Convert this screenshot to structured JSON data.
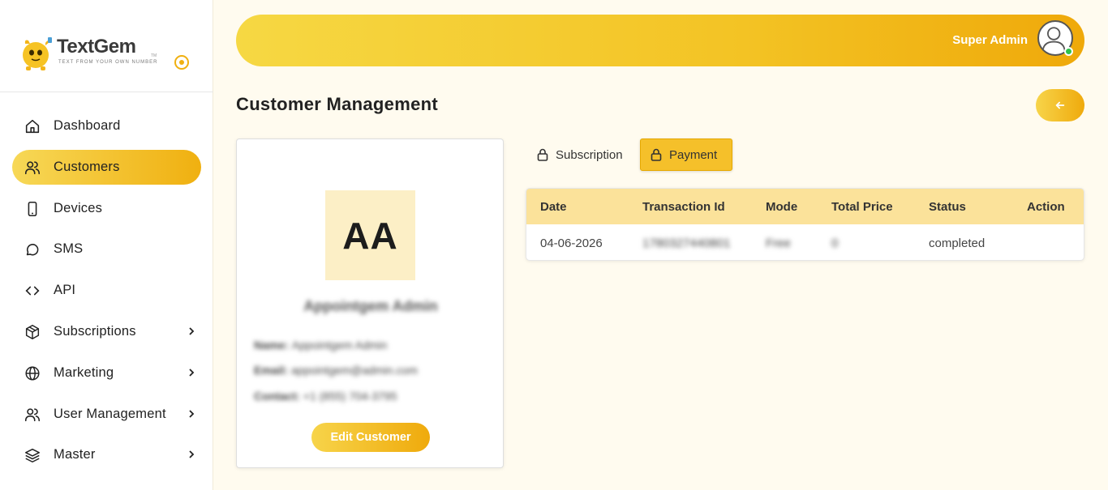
{
  "brand": {
    "name": "TextGem",
    "tagline": "TEXT FROM YOUR OWN NUMBER",
    "tm": "TM"
  },
  "sidebar": {
    "items": [
      {
        "label": "Dashboard",
        "icon": "home-icon",
        "active": false,
        "expandable": false
      },
      {
        "label": "Customers",
        "icon": "users-icon",
        "active": true,
        "expandable": false
      },
      {
        "label": "Devices",
        "icon": "phone-icon",
        "active": false,
        "expandable": false
      },
      {
        "label": "SMS",
        "icon": "chat-bubble-icon",
        "active": false,
        "expandable": false
      },
      {
        "label": "API",
        "icon": "code-icon",
        "active": false,
        "expandable": false
      },
      {
        "label": "Subscriptions",
        "icon": "package-icon",
        "active": false,
        "expandable": true
      },
      {
        "label": "Marketing",
        "icon": "globe-icon",
        "active": false,
        "expandable": true
      },
      {
        "label": "User Management",
        "icon": "users-icon",
        "active": false,
        "expandable": true
      },
      {
        "label": "Master",
        "icon": "layers-icon",
        "active": false,
        "expandable": true
      }
    ]
  },
  "header": {
    "user_name": "Super Admin",
    "status_color": "#2fc24a"
  },
  "page": {
    "title": "Customer Management"
  },
  "customer": {
    "initials": "AA",
    "display_name": "Appointgem Admin",
    "name_label": "Name:",
    "name_value": "Appointgem Admin",
    "email_label": "Email:",
    "email_value": "appointgem@admin.com",
    "contact_label": "Contact:",
    "contact_value": "+1 (855) 704-3795",
    "edit_label": "Edit Customer"
  },
  "tabs": [
    {
      "label": "Subscription",
      "active": false
    },
    {
      "label": "Payment",
      "active": true
    }
  ],
  "table": {
    "columns": [
      "Date",
      "Transaction Id",
      "Mode",
      "Total Price",
      "Status",
      "Action"
    ],
    "rows": [
      {
        "date": "04-06-2026",
        "transaction_id": "1780327440801",
        "mode": "Free",
        "total_price": "0",
        "status": "completed",
        "action": ""
      }
    ]
  },
  "colors": {
    "accent_start": "#f7d857",
    "accent_end": "#efaa0c",
    "table_header": "#fbe29a",
    "background": "#fffbef"
  }
}
